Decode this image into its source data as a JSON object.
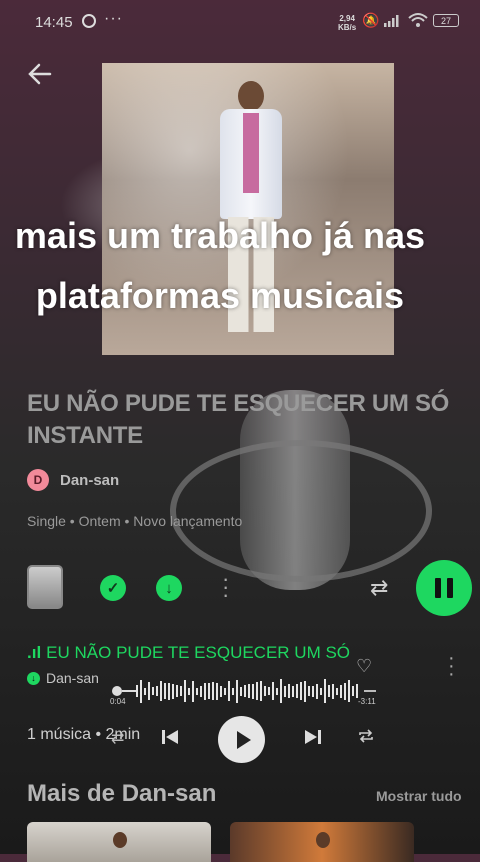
{
  "status_bar": {
    "time": "14:45",
    "menu_dots": "···",
    "net_speed_value": "2,94",
    "net_speed_unit": "KB/s",
    "battery": "27"
  },
  "overlay_caption": "mais um trabalho já nas plataformas musicais",
  "release": {
    "title": "EU NÃO PUDE TE ESQUECER UM SÓ INSTANTE",
    "artist": "Dan-san",
    "artist_initial": "D",
    "meta": "Single • Ontem • Novo lançamento"
  },
  "track": {
    "title": "EU NÃO PUDE TE ESQUECER UM SÓ INSTANTE",
    "artist": "Dan-san",
    "position": "0:04",
    "remaining": "-3:11"
  },
  "summary": "1 música • 2min",
  "more_section": {
    "heading": "Mais de Dan-san",
    "link": "Mostrar tudo"
  },
  "colors": {
    "accent": "#1ed760",
    "artist_avatar": "#f28a9a"
  },
  "icons": [
    "back-arrow-icon",
    "whatsapp-icon",
    "mute-icon",
    "signal-icon",
    "wifi-icon",
    "battery-icon",
    "check-icon",
    "download-icon",
    "more-icon",
    "shuffle-icon",
    "pause-icon",
    "heart-icon",
    "previous-icon",
    "play-icon",
    "next-icon",
    "repeat-icon"
  ]
}
